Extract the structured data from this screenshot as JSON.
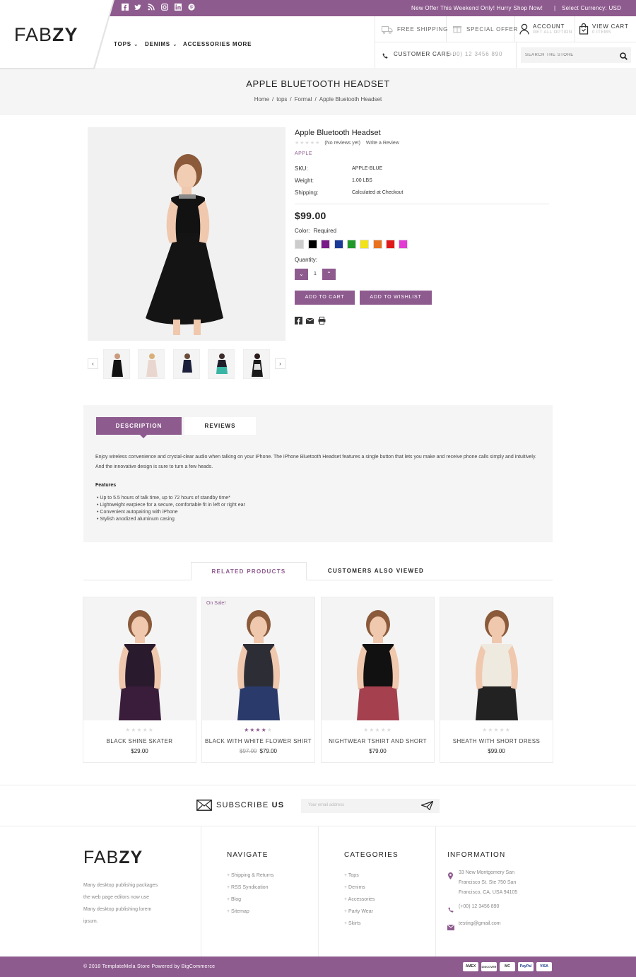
{
  "topbar": {
    "social_icons": [
      "facebook-icon",
      "twitter-icon",
      "rss-icon",
      "instagram-icon",
      "linkedin-icon",
      "pinterest-icon"
    ],
    "promo": "New Offer This Weekend Only! Hurry Shop Now!",
    "currency": "Select Currency: USD"
  },
  "header": {
    "logo_light": "FAB",
    "logo_bold": "ZY",
    "nav": [
      "TOPS",
      "DENIMS",
      "ACCESSORIES",
      "MORE"
    ],
    "free_shipping": "FREE SHIPPING",
    "special_offer": "SPECIAL OFFER",
    "account": "ACCOUNT",
    "account_sub": "GET ALL OPTION",
    "view_cart": "VIEW CART",
    "cart_sub": "0 ITEMS",
    "customer_care_label": "CUSTOMER CARE :",
    "customer_care_phone": "(+00) 12 3456 890",
    "search_placeholder": "SEARCH THE STORE"
  },
  "page": {
    "title": "APPLE BLUETOOTH HEADSET",
    "breadcrumb": [
      "Home",
      "tops",
      "Formal",
      "Apple Bluetooth Headset"
    ]
  },
  "product": {
    "name": "Apple Bluetooth Headset",
    "rating": 0,
    "no_reviews": "(No reviews yet)",
    "write_review": "Write a Review",
    "brand": "APPLE",
    "specs": [
      {
        "k": "SKU:",
        "v": "APPLE-BLUE"
      },
      {
        "k": "Weight:",
        "v": "1.00 LBS"
      },
      {
        "k": "Shipping:",
        "v": "Calculated at Checkout"
      }
    ],
    "price": "$99.00",
    "color_label": "Color:",
    "color_required": "Required",
    "colors": [
      "#cccccc",
      "#000000",
      "#7a1a8a",
      "#1a3a9a",
      "#1f9a2a",
      "#f2e21a",
      "#e8721f",
      "#e01a1a",
      "#e23ad3"
    ],
    "quantity_label": "Quantity:",
    "quantity": "1",
    "add_to_cart": "ADD TO CART",
    "add_to_wishlist": "ADD TO WISHLIST",
    "share_icons": [
      "facebook-icon",
      "email-icon",
      "print-icon"
    ]
  },
  "tabs": {
    "description": "DESCRIPTION",
    "reviews": "REVIEWS",
    "desc_text": "Enjoy wireless convenience and crystal-clear audio when talking on your iPhone. The iPhone Bluetooth Headset features a single button that lets you make and receive phone calls simply and intuitively. And the innovative design is sure to turn a few heads.",
    "features_title": "Features",
    "features": [
      "Up to 5.5 hours of talk time, up to 72 hours of standby time*",
      "Lightweight earpiece for a secure, comfortable fit in left or right ear",
      "Convenient autopairing with iPhone",
      "Stylish anodized aluminum casing"
    ]
  },
  "related": {
    "tab_related": "RELATED PRODUCTS",
    "tab_viewed": "CUSTOMERS ALSO VIEWED",
    "sale_badge": "On Sale!",
    "items": [
      {
        "name": "BLACK SHINE SKATER",
        "price": "$29.00",
        "old_price": "",
        "rating": 0,
        "top": "#2a1a2e",
        "accent": "#3a1d3a"
      },
      {
        "name": "BLACK WITH WHITE FLOWER SHIRT",
        "price": "$79.00",
        "old_price": "$97.00",
        "rating": 4,
        "top": "#2d2d35",
        "accent": "#2a3a6a"
      },
      {
        "name": "NIGHTWEAR TSHIRT AND SHORT",
        "price": "$79.00",
        "old_price": "",
        "rating": 0,
        "top": "#111111",
        "accent": "#a5404e"
      },
      {
        "name": "SHEATH WITH SHORT DRESS",
        "price": "$99.00",
        "old_price": "",
        "rating": 0,
        "top": "#efeae0",
        "accent": "#222222"
      }
    ]
  },
  "subscribe": {
    "title_light": "SUBSCRIBE",
    "title_bold": "US",
    "placeholder": "Your email address"
  },
  "footer": {
    "logo_light": "FAB",
    "logo_bold": "ZY",
    "about": [
      "Many desktop publishig packages",
      "the web page editors now use",
      "Many desktop publishing lorem",
      "ipsum."
    ],
    "navigate_title": "NAVIGATE",
    "navigate": [
      "Shipping & Returns",
      "RSS Syndication",
      "Blog",
      "Sitemap"
    ],
    "categories_title": "CATEGORIES",
    "categories": [
      "Tops",
      "Denims",
      "Accessories",
      "Party Wear",
      "Skirts"
    ],
    "information_title": "INFORMATION",
    "address": [
      "33 New Montgomery San",
      "Francisco St. Ste 750 San",
      "Francisco, CA, USA 94105"
    ],
    "phone": "(+00) 12 3456 890",
    "email": "testing@gmail.com",
    "copyright": "© 2018 TemplateMela Store Powered by BigCommerce",
    "payments": [
      "AMEX",
      "DISCOVER",
      "MC",
      "PayPal",
      "VISA"
    ]
  },
  "colors": {
    "accent": "#8e5b8f"
  }
}
